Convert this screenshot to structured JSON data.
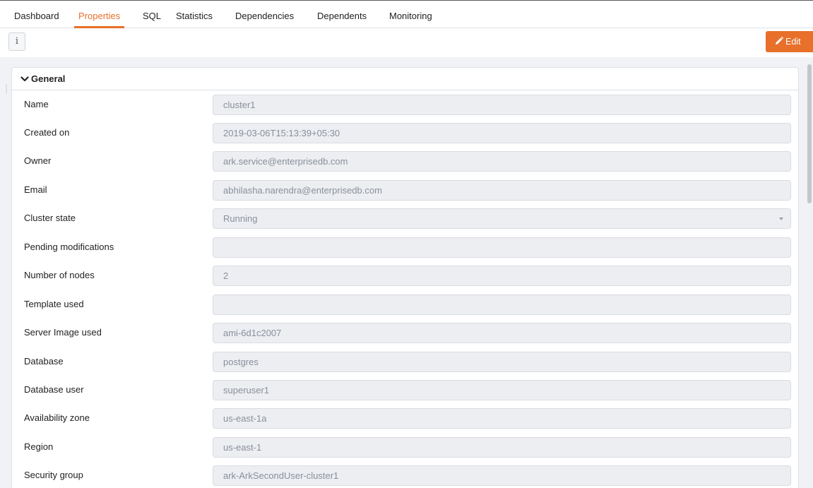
{
  "tabs": [
    {
      "label": "Dashboard",
      "active": false
    },
    {
      "label": "Properties",
      "active": true
    },
    {
      "label": "SQL",
      "active": false
    },
    {
      "label": "Statistics",
      "active": false
    },
    {
      "label": "Dependencies",
      "active": false
    },
    {
      "label": "Dependents",
      "active": false
    },
    {
      "label": "Monitoring",
      "active": false
    }
  ],
  "toolbar": {
    "info_glyph": "i",
    "info_icon": "info-icon",
    "edit_label": "Edit",
    "edit_icon": "pencil-icon",
    "accent_color": "#e8702a"
  },
  "section": {
    "title": "General",
    "icon": "chevron-down-icon",
    "fields": [
      {
        "label": "Name",
        "value": "cluster1"
      },
      {
        "label": "Created on",
        "value": "2019-03-06T15:13:39+05:30"
      },
      {
        "label": "Owner",
        "value": "ark.service@enterprisedb.com"
      },
      {
        "label": "Email",
        "value": "abhilasha.narendra@enterprisedb.com"
      },
      {
        "label": "Cluster state",
        "value": "Running",
        "type": "select"
      },
      {
        "label": "Pending modifications",
        "value": ""
      },
      {
        "label": "Number of nodes",
        "value": "2"
      },
      {
        "label": "Template used",
        "value": ""
      },
      {
        "label": "Server Image used",
        "value": "ami-6d1c2007"
      },
      {
        "label": "Database",
        "value": "postgres"
      },
      {
        "label": "Database user",
        "value": "superuser1"
      },
      {
        "label": "Availability zone",
        "value": "us-east-1a"
      },
      {
        "label": "Region",
        "value": "us-east-1"
      },
      {
        "label": "Security group",
        "value": "ark-ArkSecondUser-cluster1"
      }
    ]
  }
}
